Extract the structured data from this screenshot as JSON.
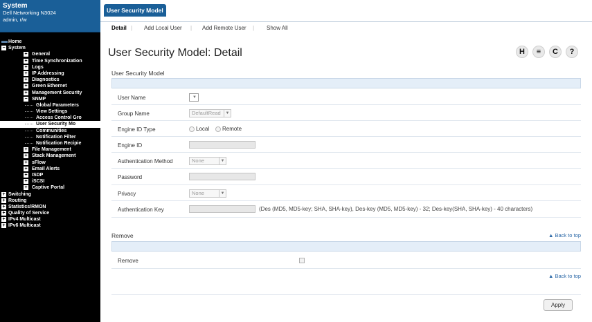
{
  "header": {
    "system_label": "System",
    "device_name": "Dell Networking N3024",
    "user": "admin, r/w"
  },
  "tree": [
    {
      "label": "Home",
      "level": 0,
      "icon": "home-icon"
    },
    {
      "label": "System",
      "level": 0,
      "icon": "minus"
    },
    {
      "label": "General",
      "level": 1,
      "icon": "plus"
    },
    {
      "label": "Time Synchronization",
      "level": 1,
      "icon": "plus"
    },
    {
      "label": "Logs",
      "level": 1,
      "icon": "plus"
    },
    {
      "label": "IP Addressing",
      "level": 1,
      "icon": "plus"
    },
    {
      "label": "Diagnostics",
      "level": 1,
      "icon": "plus"
    },
    {
      "label": "Green Ethernet",
      "level": 1,
      "icon": "plus"
    },
    {
      "label": "Management Security",
      "level": 1,
      "icon": "plus"
    },
    {
      "label": "SNMP",
      "level": 1,
      "icon": "minus"
    },
    {
      "label": "Global Parameters",
      "level": 2,
      "icon": "none"
    },
    {
      "label": "View Settings",
      "level": 2,
      "icon": "none"
    },
    {
      "label": "Access Control Gro",
      "level": 2,
      "icon": "none"
    },
    {
      "label": "User Security Mo",
      "level": 2,
      "icon": "none",
      "selected": true
    },
    {
      "label": "Communities",
      "level": 2,
      "icon": "none"
    },
    {
      "label": "Notification Filter",
      "level": 2,
      "icon": "none"
    },
    {
      "label": "Notification Recipie",
      "level": 2,
      "icon": "none"
    },
    {
      "label": "File Management",
      "level": 1,
      "icon": "plus"
    },
    {
      "label": "Stack Management",
      "level": 1,
      "icon": "plus"
    },
    {
      "label": "sFlow",
      "level": 1,
      "icon": "plus"
    },
    {
      "label": "Email Alerts",
      "level": 1,
      "icon": "plus"
    },
    {
      "label": "ISDP",
      "level": 1,
      "icon": "plus"
    },
    {
      "label": "iSCSI",
      "level": 1,
      "icon": "plus"
    },
    {
      "label": "Captive Portal",
      "level": 1,
      "icon": "plus"
    },
    {
      "label": "Switching",
      "level": 0,
      "icon": "plus"
    },
    {
      "label": "Routing",
      "level": 0,
      "icon": "plus"
    },
    {
      "label": "Statistics/RMON",
      "level": 0,
      "icon": "plus"
    },
    {
      "label": "Quality of Service",
      "level": 0,
      "icon": "plus"
    },
    {
      "label": "IPv4 Multicast",
      "level": 0,
      "icon": "plus"
    },
    {
      "label": "IPv6 Multicast",
      "level": 0,
      "icon": "plus"
    }
  ],
  "top_tab": "User Security Model",
  "subnav": {
    "detail": "Detail",
    "add_local_user": "Add Local User",
    "add_remote_user": "Add Remote User",
    "show_all": "Show All"
  },
  "page_title": "User Security Model: Detail",
  "toolbar": {
    "help_glyph": "?",
    "refresh_glyph": "C",
    "print_glyph": "≡",
    "save_glyph": "H"
  },
  "form": {
    "section_title": "User Security Model",
    "user_name_label": "User Name",
    "group_name_label": "Group Name",
    "group_name_value": "DefaultRead",
    "engine_id_type_label": "Engine ID Type",
    "engine_local": "Local",
    "engine_remote": "Remote",
    "engine_id_label": "Engine ID",
    "auth_method_label": "Authentication Method",
    "auth_method_value": "None",
    "password_label": "Password",
    "privacy_label": "Privacy",
    "privacy_value": "None",
    "auth_key_label": "Authentication Key",
    "auth_key_hint": "(Des (MD5, MD5-key; SHA, SHA-key), Des-key (MD5, MD5-key) - 32; Des-key(SHA, SHA-key) - 40 characters)"
  },
  "remove_section": {
    "title": "Remove",
    "remove_label": "Remove"
  },
  "back_to_top": "Back to top",
  "apply_label": "Apply"
}
